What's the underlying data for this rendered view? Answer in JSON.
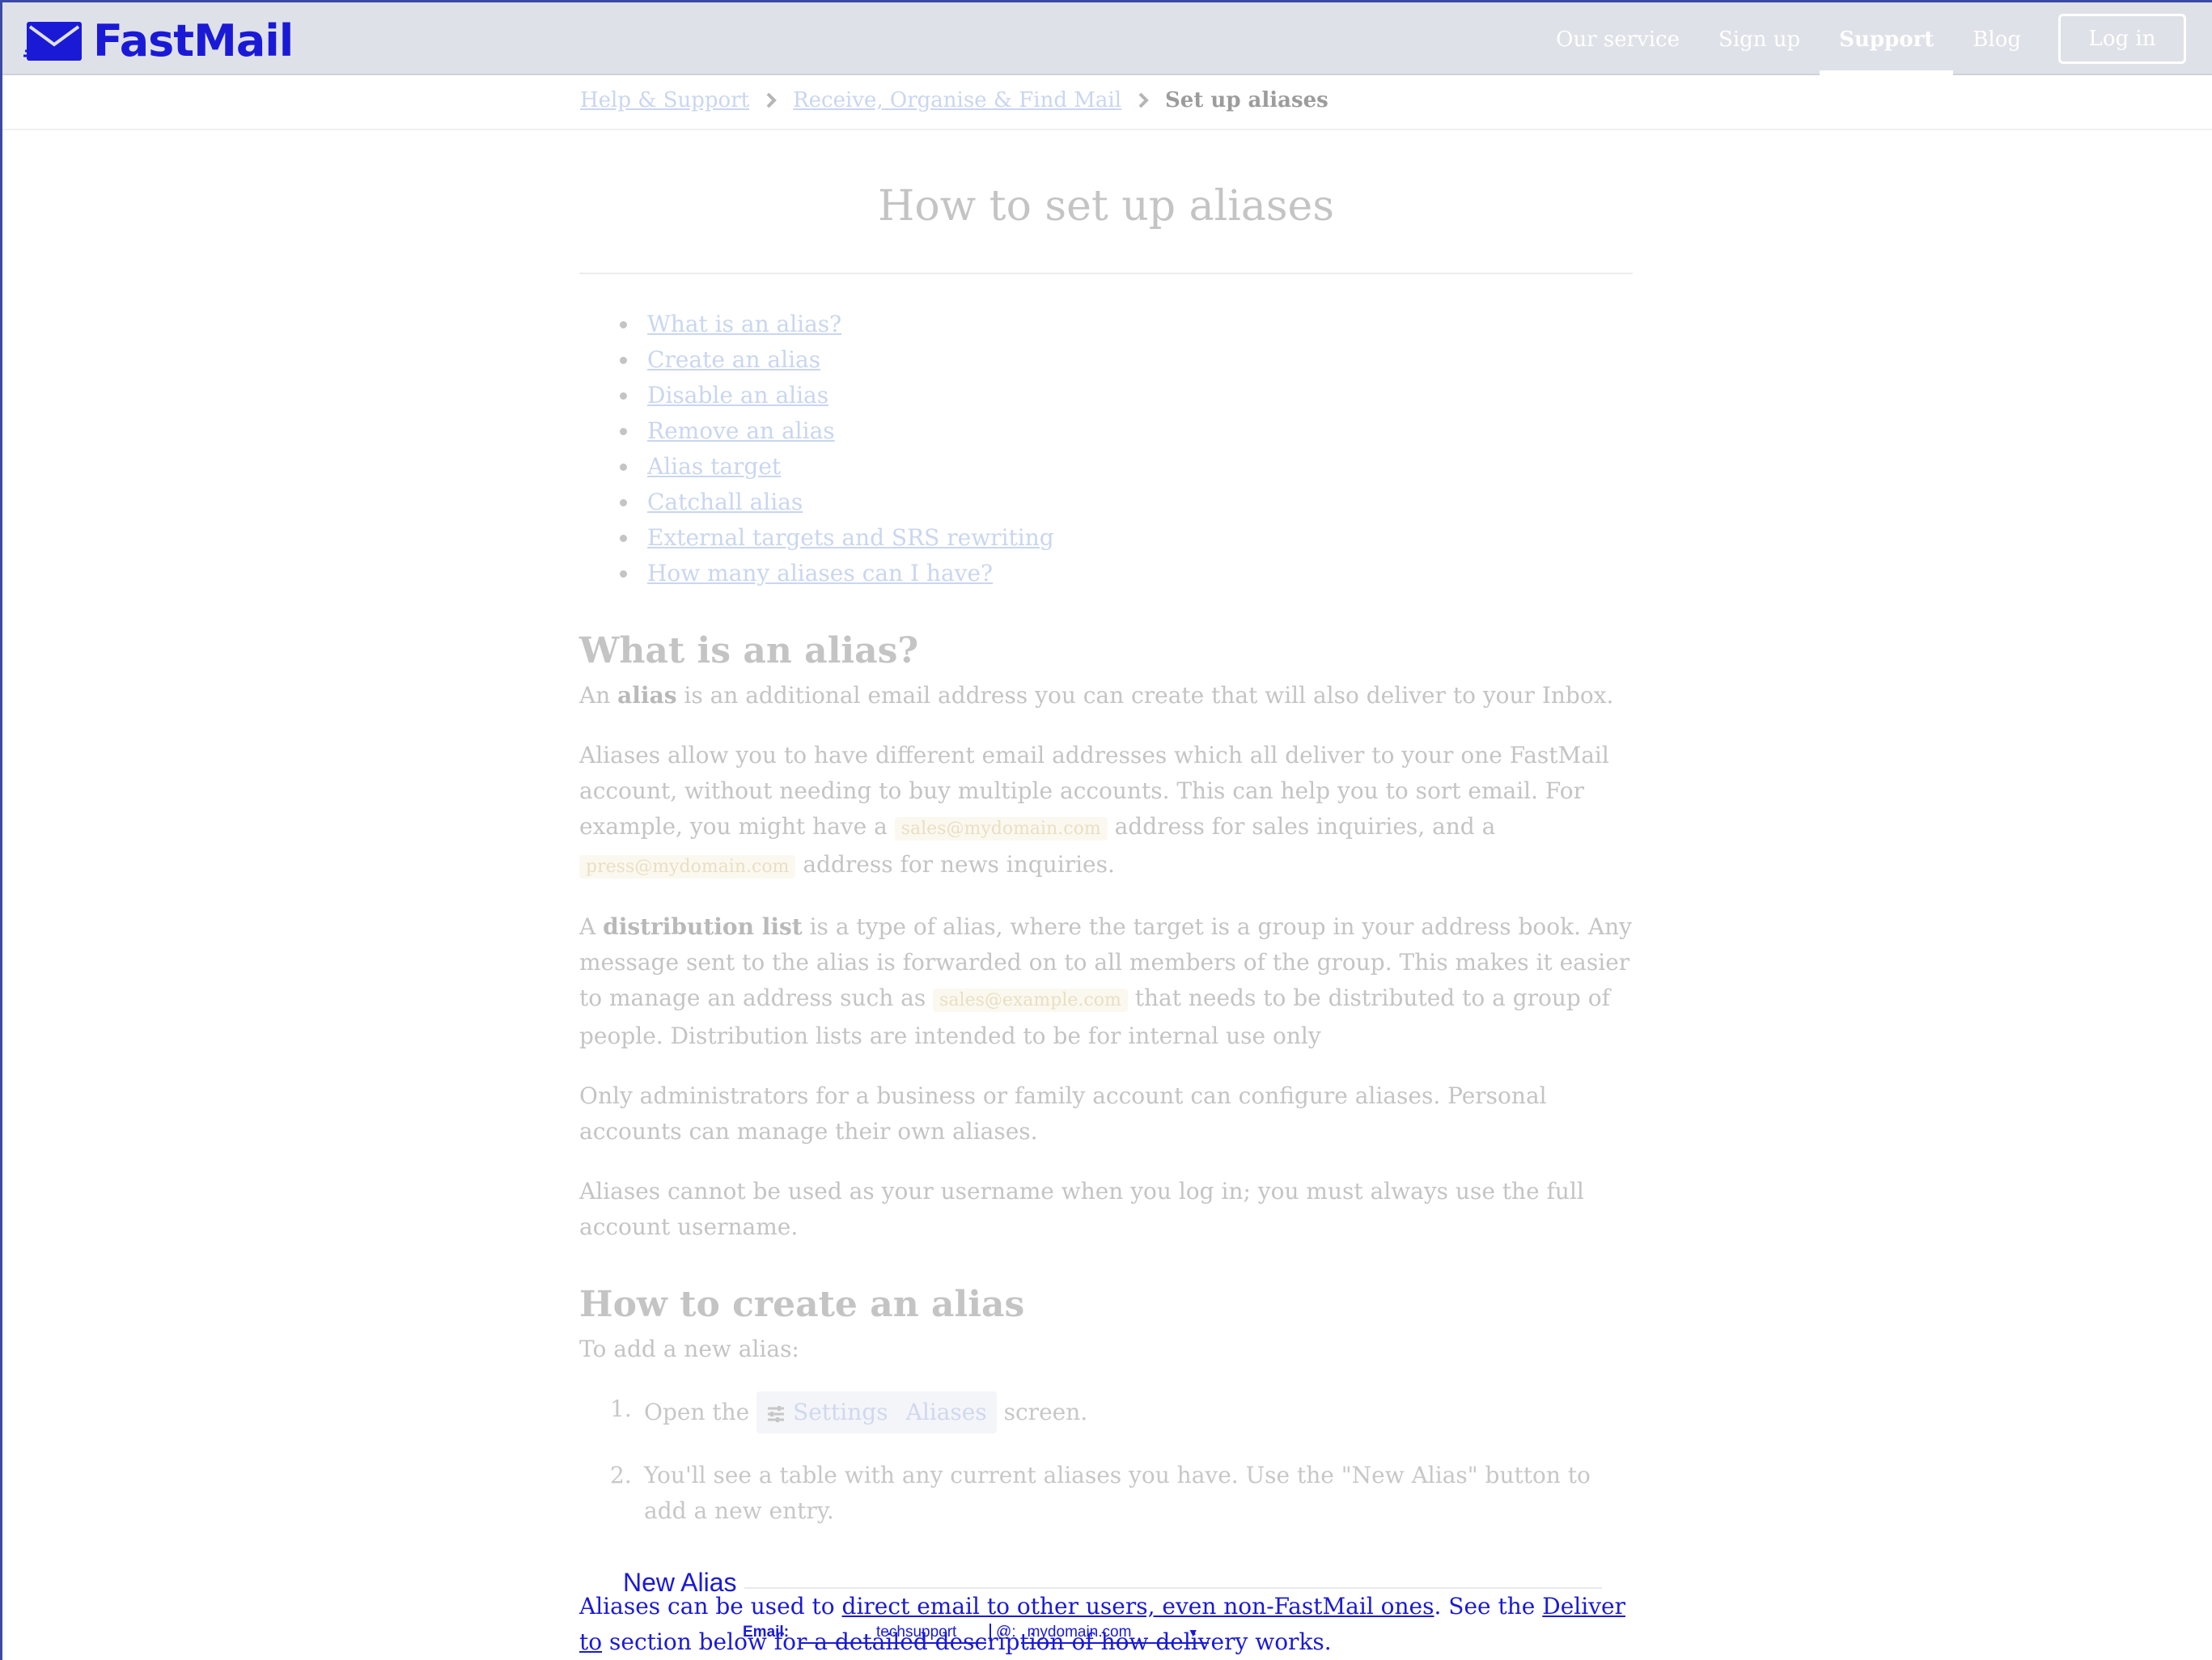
{
  "header": {
    "logo_text": "FastMail",
    "brand_color": "#1a1ad6",
    "nav": [
      {
        "label": "Our service"
      },
      {
        "label": "Sign up"
      },
      {
        "label": "Support",
        "active": true
      },
      {
        "label": "Blog"
      }
    ],
    "login_label": "Log in"
  },
  "breadcrumb": {
    "items": [
      "Help & Support",
      "Receive, Organise & Find Mail"
    ],
    "current": "Set up aliases"
  },
  "page": {
    "title": "How to set up aliases",
    "toc": [
      "What is an alias?",
      "Create an alias",
      "Disable an alias",
      "Remove an alias",
      "Alias target",
      "Catchall alias",
      "External targets and SRS rewriting",
      "How many aliases can I have?"
    ]
  },
  "section1": {
    "heading": "What is an alias?",
    "p1_prefix": "An ",
    "p1_bold": "alias",
    "p1_rest": " is an additional email address you can create that will also deliver to your Inbox.",
    "p2_a": "Aliases allow you to have different email addresses which all deliver to your one FastMail account, without needing to buy multiple accounts. This can help you to sort email. For example, you might have a ",
    "p2_code1": "sales@mydomain.com",
    "p2_b": " address for sales inquiries, and a ",
    "p2_code2": "press@mydomain.com",
    "p2_c": " address for news inquiries.",
    "p3_prefix": "A ",
    "p3_bold": "distribution list",
    "p3_a": " is a type of alias, where the target is a group in your address book. Any message sent to the alias is forwarded on to all members of the group. This makes it easier to manage an address such as ",
    "p3_code": "sales@example.com",
    "p3_b": " that needs to be distributed to a group of people. Distribution lists are intended to be for internal use only",
    "p4": "Only administrators for a business or family account can configure aliases. Personal accounts can manage their own aliases.",
    "p5": "Aliases cannot be used as your username when you log in; you must always use the full account username."
  },
  "section2": {
    "heading": "How to create an alias",
    "intro": "To add a new alias:",
    "step1_num": "1.",
    "step1_pre": "Open the ",
    "step1_path1": "Settings",
    "step1_path2": "Aliases",
    "step1_post": " screen.",
    "step2_num": "2.",
    "step2": "You'll see a table with any current aliases you have. Use the \"New Alias\" button to add a new entry."
  },
  "overlay": {
    "new_alias_title": "New Alias",
    "para_a": "Aliases can be used to ",
    "para_link1": "direct email to other users, even non-FastMail ones",
    "para_b": ". See the ",
    "para_link2": "Deliver to",
    "para_c": " section below for a detailed description of how delivery works.",
    "email_label": "Email:",
    "email_value": "techsupport",
    "at_sign": "@:",
    "domain_value": "mydomain.com"
  }
}
